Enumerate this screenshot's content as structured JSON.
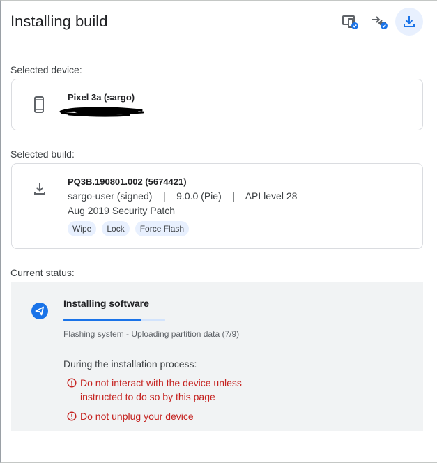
{
  "header": {
    "title": "Installing build",
    "icons": [
      "device-check-icon",
      "compare-check-icon",
      "download-icon"
    ]
  },
  "device": {
    "label": "Selected device:",
    "name": "Pixel 3a (sargo)",
    "icon": "phone-icon"
  },
  "build": {
    "label": "Selected build:",
    "id": "PQ3B.190801.002 (5674421)",
    "meta": "sargo-user (signed)    |    9.0.0 (Pie)    |    API level 28",
    "patch": "Aug 2019 Security Patch",
    "chips": [
      "Wipe",
      "Lock",
      "Force Flash"
    ],
    "icon": "download-icon"
  },
  "status": {
    "label": "Current status:",
    "title": "Installing software",
    "progress": 0.77,
    "detail": "Flashing system - Uploading partition data (7/9)",
    "process_heading": "During the installation process:",
    "warnings": [
      "Do not interact with the device unless instructed to do so by this page",
      "Do not unplug your device"
    ],
    "colors": {
      "accent": "#1a73e8",
      "warning": "#c5221f"
    }
  }
}
